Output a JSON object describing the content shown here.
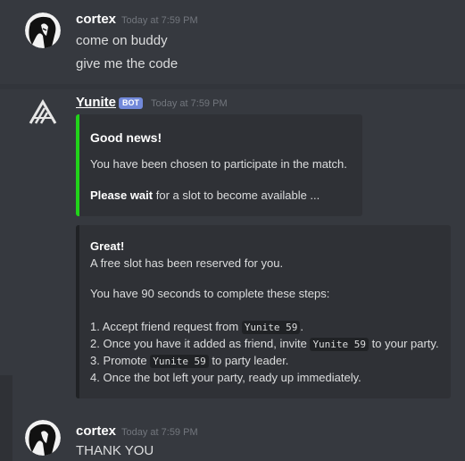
{
  "messages": [
    {
      "author": "cortex",
      "time": "Today at 7:59 PM",
      "lines": [
        "come on buddy",
        "give me the code"
      ]
    },
    {
      "author": "Yunite",
      "badge": "BOT",
      "time": "Today at 7:59 PM",
      "embed1": {
        "title": "Good news!",
        "desc": "You have been chosen to participate in the match.",
        "wait_bold": "Please wait",
        "wait_rest": " for a slot to become available ...",
        "color": "#43b581"
      },
      "embed2": {
        "title": "Great!",
        "line1": "A free slot has been reserved for you.",
        "line2": "You have 90 seconds to complete these steps:",
        "step1_pre": "1. Accept friend request from ",
        "step1_code": "Yunite 59",
        "step1_post": ".",
        "step2_pre": "2. Once you have it added as friend, invite ",
        "step2_code": "Yunite 59",
        "step2_post": " to your party.",
        "step3_pre": "3. Promote ",
        "step3_code": "Yunite 59",
        "step3_post": " to party leader.",
        "step4": "4. Once the bot left your party, ready up immediately.",
        "color": "#202225"
      }
    },
    {
      "author": "cortex",
      "time": "Today at 7:59 PM",
      "lines": [
        "THANK YOU"
      ]
    }
  ],
  "icons": {
    "avatar_cortex": "anime-avatar-icon",
    "avatar_yunite": "yunite-logo-icon"
  }
}
